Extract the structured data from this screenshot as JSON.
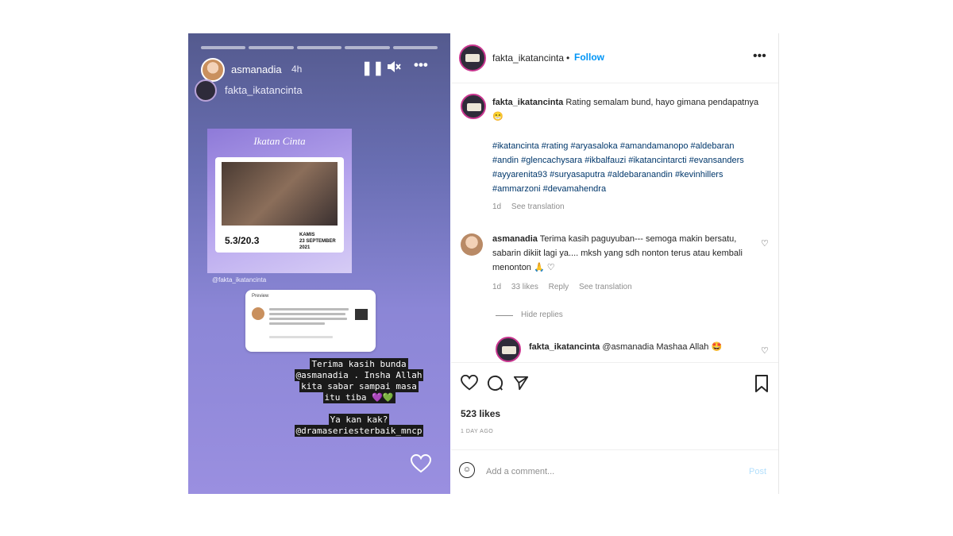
{
  "story": {
    "username": "asmanadia",
    "time": "4h",
    "controls": {
      "pause_icon": "pause-icon",
      "mute_icon": "mute-icon",
      "more_icon": "more-icon"
    },
    "repost_username": "fakta_ikatancinta",
    "post_card": {
      "title": "Ikatan Cinta",
      "rating": "5.3/20.3",
      "day": "KAMIS",
      "date": "23 SEPTEMBER 2021"
    },
    "post_handle": "@fakta_ikatancinta",
    "share_card_label": "Preview",
    "caption_lines": [
      "Terima kasih bunda",
      "@asmanadia . Insha Allah",
      "kita sabar sampai masa",
      "itu tiba 💜💚",
      "",
      "Ya kan kak?",
      "@dramaseriesterbaik_mncp"
    ],
    "heart_icon": "heart-outline-icon"
  },
  "post": {
    "header": {
      "username": "fakta_ikatancinta",
      "dot": "•",
      "follow": "Follow",
      "more": "•••"
    },
    "caption": {
      "username": "fakta_ikatancinta",
      "text": "Rating semalam bund, hayo gimana pendapatnya 😁",
      "hashtags": "#ikatancinta #rating #aryasaloka #amandamanopo #aldebaran #andin #glencachysara #ikbalfauzi #ikatancintarcti #evansanders #ayyarenita93 #suryasaputra #aldebaranandin #kevinhillers #ammarzoni #devamahendra",
      "age": "1d",
      "see_translation": "See translation"
    },
    "comment1": {
      "username": "asmanadia",
      "text": "Terima kasih paguyuban--- semoga makin bersatu, sabarin dikiit lagi ya.... mksh yang sdh nonton terus atau kembali menonton 🙏 ♡",
      "age": "1d",
      "likes": "33 likes",
      "reply": "Reply",
      "see_translation": "See translation",
      "hide_replies": "Hide replies"
    },
    "reply1": {
      "username": "fakta_ikatancinta",
      "text": "@asmanadia Mashaa Allah 🤩"
    },
    "likes_count": "523 likes",
    "time_ago": "1 DAY AGO",
    "add_comment_placeholder": "Add a comment...",
    "post_button": "Post",
    "icons": {
      "like": "heart-icon",
      "comment": "comment-icon",
      "share": "share-icon",
      "save": "bookmark-icon",
      "emoji": "emoji-icon"
    }
  }
}
